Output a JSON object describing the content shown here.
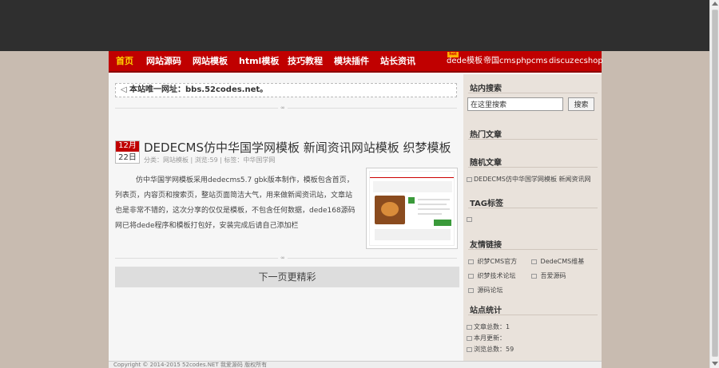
{
  "nav": {
    "items": [
      "首页",
      "网站源码",
      "网站模板",
      "html模板",
      "技巧教程",
      "模块插件",
      "站长资讯"
    ],
    "right_items": [
      "dede模板",
      "帝国cms",
      "phpcms",
      "discuz",
      "ecshop"
    ],
    "hot_badge": "hot"
  },
  "notice": {
    "text": "本站唯一网址：bbs.52codes.net。"
  },
  "post": {
    "month": "12月",
    "day": "22日",
    "title": "DEDECMS仿中华国学网模板 新闻资讯网站模板 织梦模板",
    "meta": "分类：网站模板 | 浏览:59 | 标签：中华国学网",
    "body": "仿中华国学网模板采用dedecms5.7 gbk版本制作，模板包含首页，列表页，内容页和搜索页，整站页面简洁大气，用来做新闻资讯站，文章站也是非常不错的，这次分享的仅仅是模板，不包含任何数据，dede168源码网已将dede程序和模板打包好，安装完成后请自己添加栏"
  },
  "next_page": "下一页更精彩",
  "footer": "Copyright © 2014-2015 52codes.NET 我爱源码 版权所有",
  "sidebar": {
    "search_title": "站内搜索",
    "search_placeholder": "在这里搜索",
    "search_button": "搜索",
    "hot_title": "热门文章",
    "random_title": "随机文章",
    "random_items": [
      "DEDECMS仿中华国学网模板 新闻资讯网"
    ],
    "tag_title": "TAG标签",
    "links_title": "友情链接",
    "links": [
      "织梦CMS官方",
      "DedeCMS维基",
      "织梦技术论坛",
      "吾爱源码",
      "源码论坛"
    ],
    "stats_title": "站点统计",
    "stats": [
      "文章总数：1",
      "本月更新：",
      "浏览总数：59"
    ]
  }
}
